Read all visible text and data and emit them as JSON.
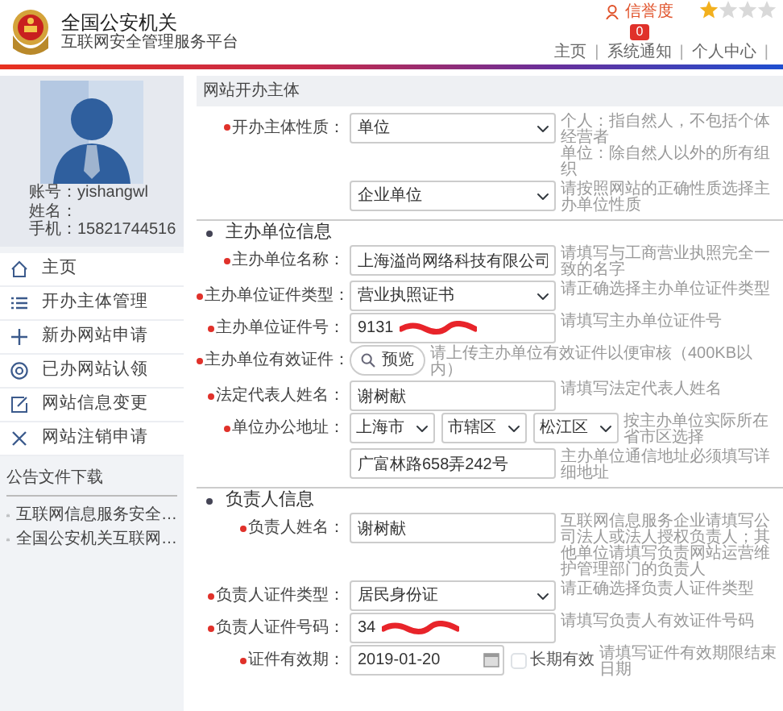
{
  "header": {
    "title": "全国公安机关",
    "subtitle": "互联网安全管理服务平台",
    "credit_label": "信誉度",
    "credit_badge": "0",
    "stars": 1,
    "nav": [
      {
        "label": "主页",
        "divider": "|"
      },
      {
        "label": "系统通知",
        "divider": "|"
      },
      {
        "label": "个人中心",
        "divider": "|"
      }
    ]
  },
  "profile": {
    "account": "账号：yishangwl",
    "name": "姓名：",
    "phone": "手机：15821744516"
  },
  "menu": [
    {
      "label": "主页"
    },
    {
      "label": "开办主体管理"
    },
    {
      "label": "新办网站申请"
    },
    {
      "label": "已办网站认领"
    },
    {
      "label": "网站信息变更"
    },
    {
      "label": "网站注销申请"
    }
  ],
  "downloads": {
    "title": "公告文件下载",
    "files": [
      "互联网信息服务安全…",
      "全国公安机关互联网…"
    ]
  },
  "form": {
    "title": "网站开办主体",
    "sections": [
      {
        "rows": [
          {
            "kind": "select",
            "label": "开办主体性质：",
            "required": true,
            "value": "单位",
            "hints": [
              "个人：指自然人，不包括个体经营者",
              "单位：除自然人以外的所有组织"
            ]
          },
          {
            "kind": "select",
            "value": "企业单位",
            "hints": [
              "请按照网站的正确性质选择主办单位性质"
            ]
          }
        ]
      },
      {
        "heading": "主办单位信息",
        "rows": [
          {
            "kind": "text",
            "label": "主办单位名称：",
            "required": true,
            "value": "上海溢尚网络科技有限公司",
            "hints": [
              "请填写与工商营业执照完全一致的名字"
            ]
          },
          {
            "kind": "select",
            "label": "主办单位证件类型：",
            "required": true,
            "value": "营业执照证书",
            "hints": [
              "请正确选择主办单位证件类型"
            ]
          },
          {
            "kind": "text",
            "label": "主办单位证件号：",
            "required": true,
            "value": "9131",
            "redacted": true,
            "hints": [
              "请填写主办单位证件号"
            ]
          },
          {
            "kind": "upload",
            "label": "主办单位有效证件：",
            "required": true,
            "button": "预览",
            "hints": [
              "请上传主办单位有效证件以便审核（400KB以内）"
            ]
          },
          {
            "kind": "text",
            "label": "法定代表人姓名：",
            "required": true,
            "value": "谢树献",
            "hints": [
              "请填写法定代表人姓名"
            ]
          },
          {
            "kind": "address",
            "label": "单位办公地址：",
            "required": true,
            "selects": [
              "上海市",
              "市辖区",
              "松江区"
            ],
            "hints": [
              "按主办单位实际所在省市区选择"
            ]
          },
          {
            "kind": "text",
            "value": "广富林路658弄242号",
            "hints": [
              "主办单位通信地址必须填写详细地址"
            ]
          }
        ]
      },
      {
        "heading": "负责人信息",
        "rows": [
          {
            "kind": "text",
            "label": "负责人姓名：",
            "required": true,
            "value": "谢树献",
            "hints": [
              "互联网信息服务企业请填写公司法人或法人授权负责人；其他单位请填写负责网站运营维护管理部门的负责人"
            ]
          },
          {
            "kind": "select",
            "label": "负责人证件类型：",
            "required": true,
            "value": "居民身份证",
            "hints": [
              "请正确选择负责人证件类型"
            ]
          },
          {
            "kind": "text",
            "label": "负责人证件号码：",
            "required": true,
            "value": "34",
            "redacted": true,
            "hints": [
              "请填写负责人有效证件号码"
            ]
          },
          {
            "kind": "date",
            "label": "证件有效期：",
            "required": true,
            "value": "2019-01-20",
            "checkbox": {
              "label": "长期有效",
              "checked": false
            },
            "hints": [
              "请填写证件有效期限结束日期"
            ]
          }
        ]
      }
    ]
  }
}
